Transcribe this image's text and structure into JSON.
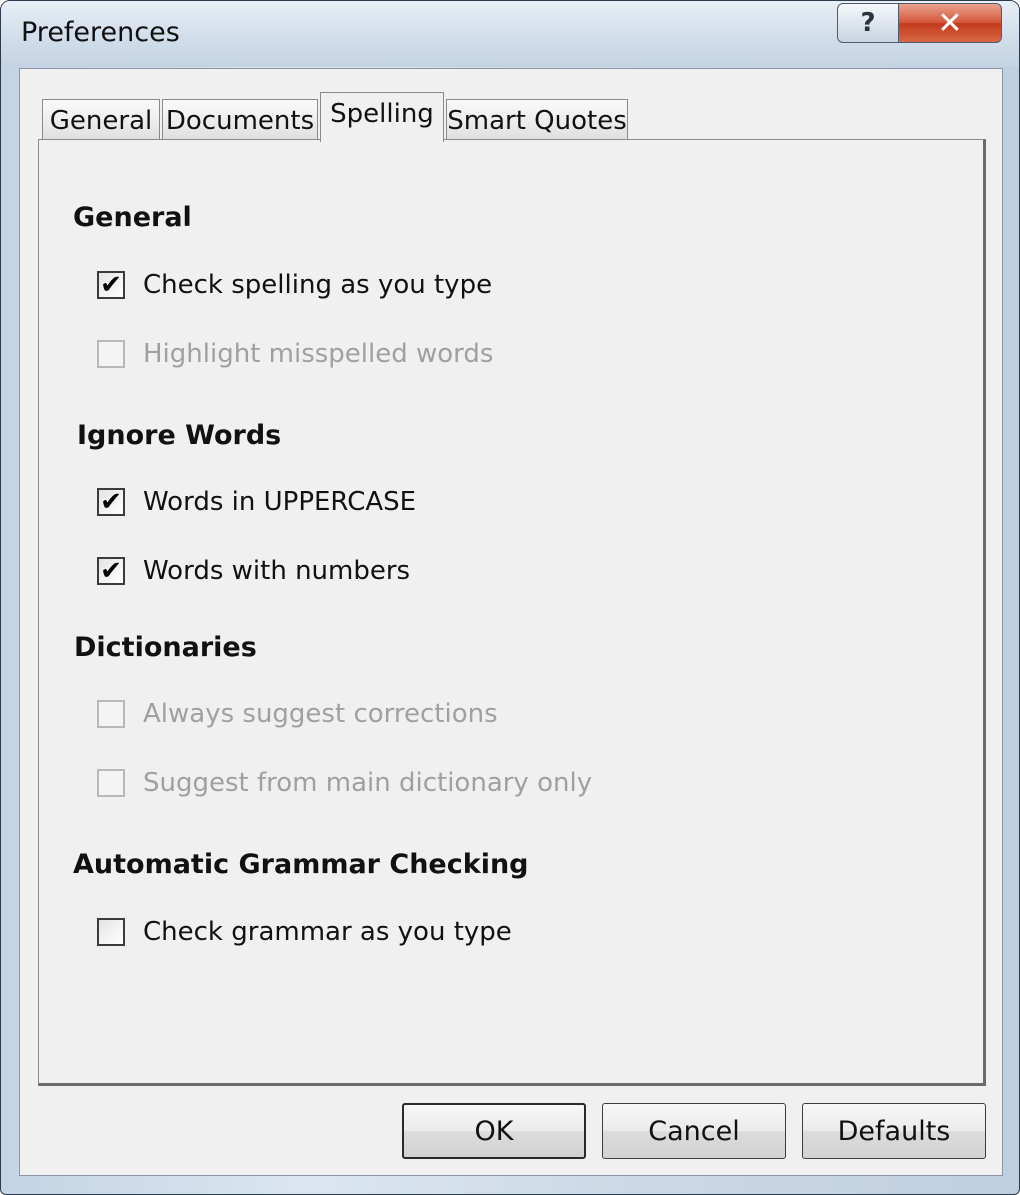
{
  "window": {
    "title": "Preferences",
    "help_glyph": "?",
    "close_glyph": "✕"
  },
  "tabs": [
    {
      "label": "General",
      "active": false
    },
    {
      "label": "Documents",
      "active": false
    },
    {
      "label": "Spelling",
      "active": true
    },
    {
      "label": "Smart Quotes",
      "active": false
    }
  ],
  "sections": {
    "general": {
      "heading": "General",
      "options": [
        {
          "label": "Check spelling as you type",
          "checked": true,
          "enabled": true
        },
        {
          "label": "Highlight misspelled words",
          "checked": false,
          "enabled": false
        }
      ]
    },
    "ignore_words": {
      "heading": "Ignore Words",
      "options": [
        {
          "label": "Words in UPPERCASE",
          "checked": true,
          "enabled": true
        },
        {
          "label": "Words with numbers",
          "checked": true,
          "enabled": true
        }
      ]
    },
    "dictionaries": {
      "heading": "Dictionaries",
      "options": [
        {
          "label": "Always suggest corrections",
          "checked": false,
          "enabled": false
        },
        {
          "label": "Suggest from main dictionary only",
          "checked": false,
          "enabled": false
        }
      ]
    },
    "grammar": {
      "heading": "Automatic Grammar Checking",
      "options": [
        {
          "label": "Check grammar as you type",
          "checked": false,
          "enabled": true
        }
      ]
    }
  },
  "buttons": {
    "ok": "OK",
    "cancel": "Cancel",
    "defaults": "Defaults"
  },
  "check_glyph": "✔"
}
